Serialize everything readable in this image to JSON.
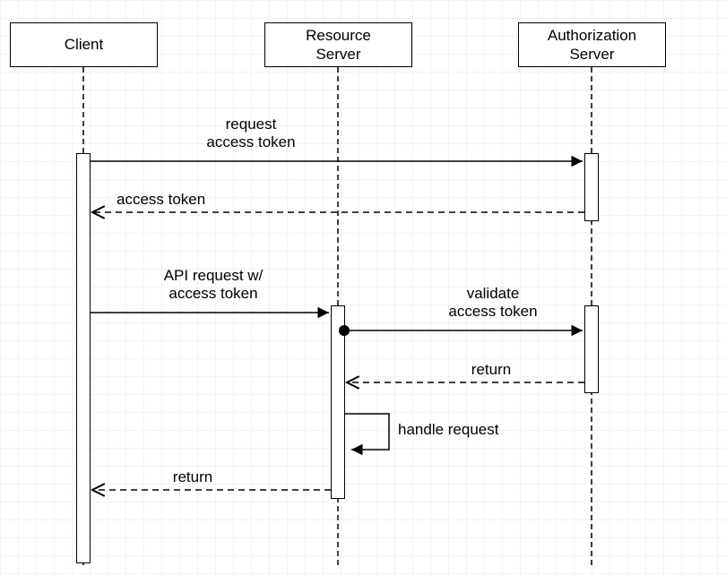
{
  "participants": {
    "client": "Client",
    "resource_server": "Resource\nServer",
    "authorization_server": "Authorization\nServer"
  },
  "messages": {
    "request_access_token": "request\naccess token",
    "access_token": "access token",
    "api_request": "API request w/\naccess token",
    "validate_access_token": "validate\naccess token",
    "return_validate": "return",
    "handle_request": "handle request",
    "return_api": "return"
  }
}
